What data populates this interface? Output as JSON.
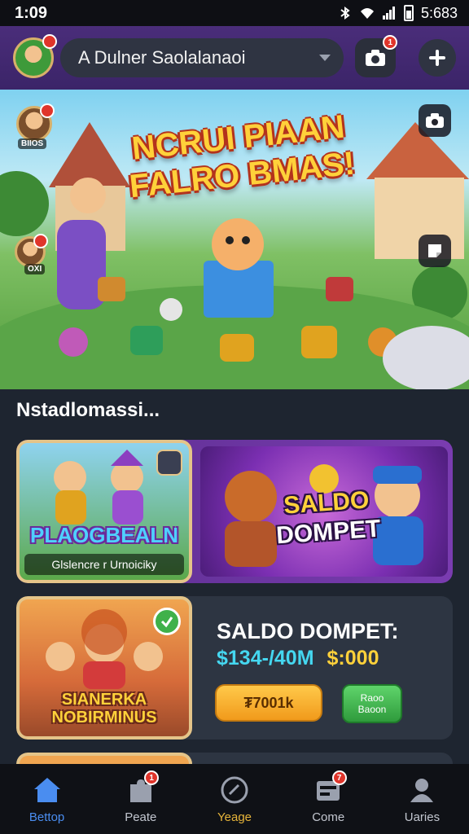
{
  "status_bar": {
    "time": "1:09",
    "right_text": "5:683"
  },
  "header": {
    "search_value": "A Dulner Saolalanaoi",
    "camera_badge": "1"
  },
  "banner": {
    "title": "NCRUI PIAAN FALRO BMAS!",
    "avatar1_label": "BIIOS",
    "avatar2_label": "OXI"
  },
  "section": {
    "title": "Nstadlomassi..."
  },
  "card1": {
    "thumb_title": "PLAOGBEALN",
    "thumb_caption": "Glslencre r Urnoiciky",
    "art_line1": "SALDO",
    "art_line2": "DOMPET"
  },
  "card2": {
    "thumb_title": "SIANERKA NOBIRMINUS",
    "title": "SALDO DOMPET:",
    "amount_cyan": "$134-/40M",
    "amount_yellow": "$:000",
    "primary_button": "₮7001k",
    "secondary_button_line1": "Raoo",
    "secondary_button_line2": "Baoon"
  },
  "bottom_nav": {
    "items": [
      {
        "label": "Bettop"
      },
      {
        "label": "Peate",
        "badge": "1"
      },
      {
        "label": "Yeage"
      },
      {
        "label": "Come",
        "badge": "7"
      },
      {
        "label": "Uaries"
      }
    ]
  },
  "colors": {
    "header_bg": "#4a2d7a",
    "page_bg": "#1e2530",
    "accent_blue": "#4a8df0",
    "accent_gold": "#ffd13a",
    "badge_red": "#e0352b"
  },
  "icons": [
    "wifi-icon",
    "signal-icon",
    "battery-icon",
    "camera-icon",
    "plus-icon",
    "home-icon",
    "puzzle-icon",
    "target-icon",
    "wallet-icon",
    "user-icon",
    "check-icon"
  ]
}
